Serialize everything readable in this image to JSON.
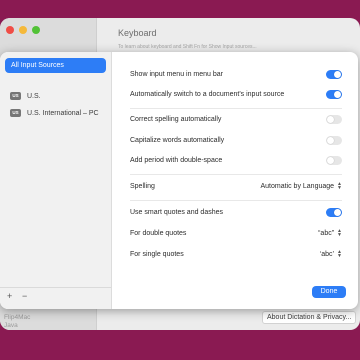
{
  "background_window": {
    "title": "Keyboard",
    "subtitle": "To learn about keyboard and Shift Fn for Show Input sources...",
    "sidebar_items": [
      "Flip4Mac",
      "Java"
    ],
    "about_button": "About Dictation & Privacy..."
  },
  "sheet": {
    "sidebar": {
      "selected_label": "All Input Sources",
      "sources": [
        {
          "badge": "US",
          "label": "U.S."
        },
        {
          "badge": "US",
          "label": "U.S. International – PC"
        }
      ],
      "add_label": "+",
      "remove_label": "−"
    },
    "settings": {
      "show_input_menu": {
        "label": "Show input menu in menu bar",
        "enabled": true
      },
      "auto_switch": {
        "label": "Automatically switch to a document's input source",
        "enabled": true
      },
      "correct_spelling": {
        "label": "Correct spelling automatically",
        "enabled": false
      },
      "capitalize_words": {
        "label": "Capitalize words automatically",
        "enabled": false
      },
      "add_period": {
        "label": "Add period with double-space",
        "enabled": false
      },
      "spelling": {
        "label": "Spelling",
        "value": "Automatic by Language"
      },
      "smart_quotes": {
        "label": "Use smart quotes and dashes",
        "enabled": true
      },
      "double_quotes": {
        "label": "For double quotes",
        "value": "“abc”"
      },
      "single_quotes": {
        "label": "For single quotes",
        "value": "‘abc’"
      }
    },
    "done_label": "Done"
  },
  "colors": {
    "accent": "#2d7df6",
    "desktop": "#8a1a52"
  }
}
